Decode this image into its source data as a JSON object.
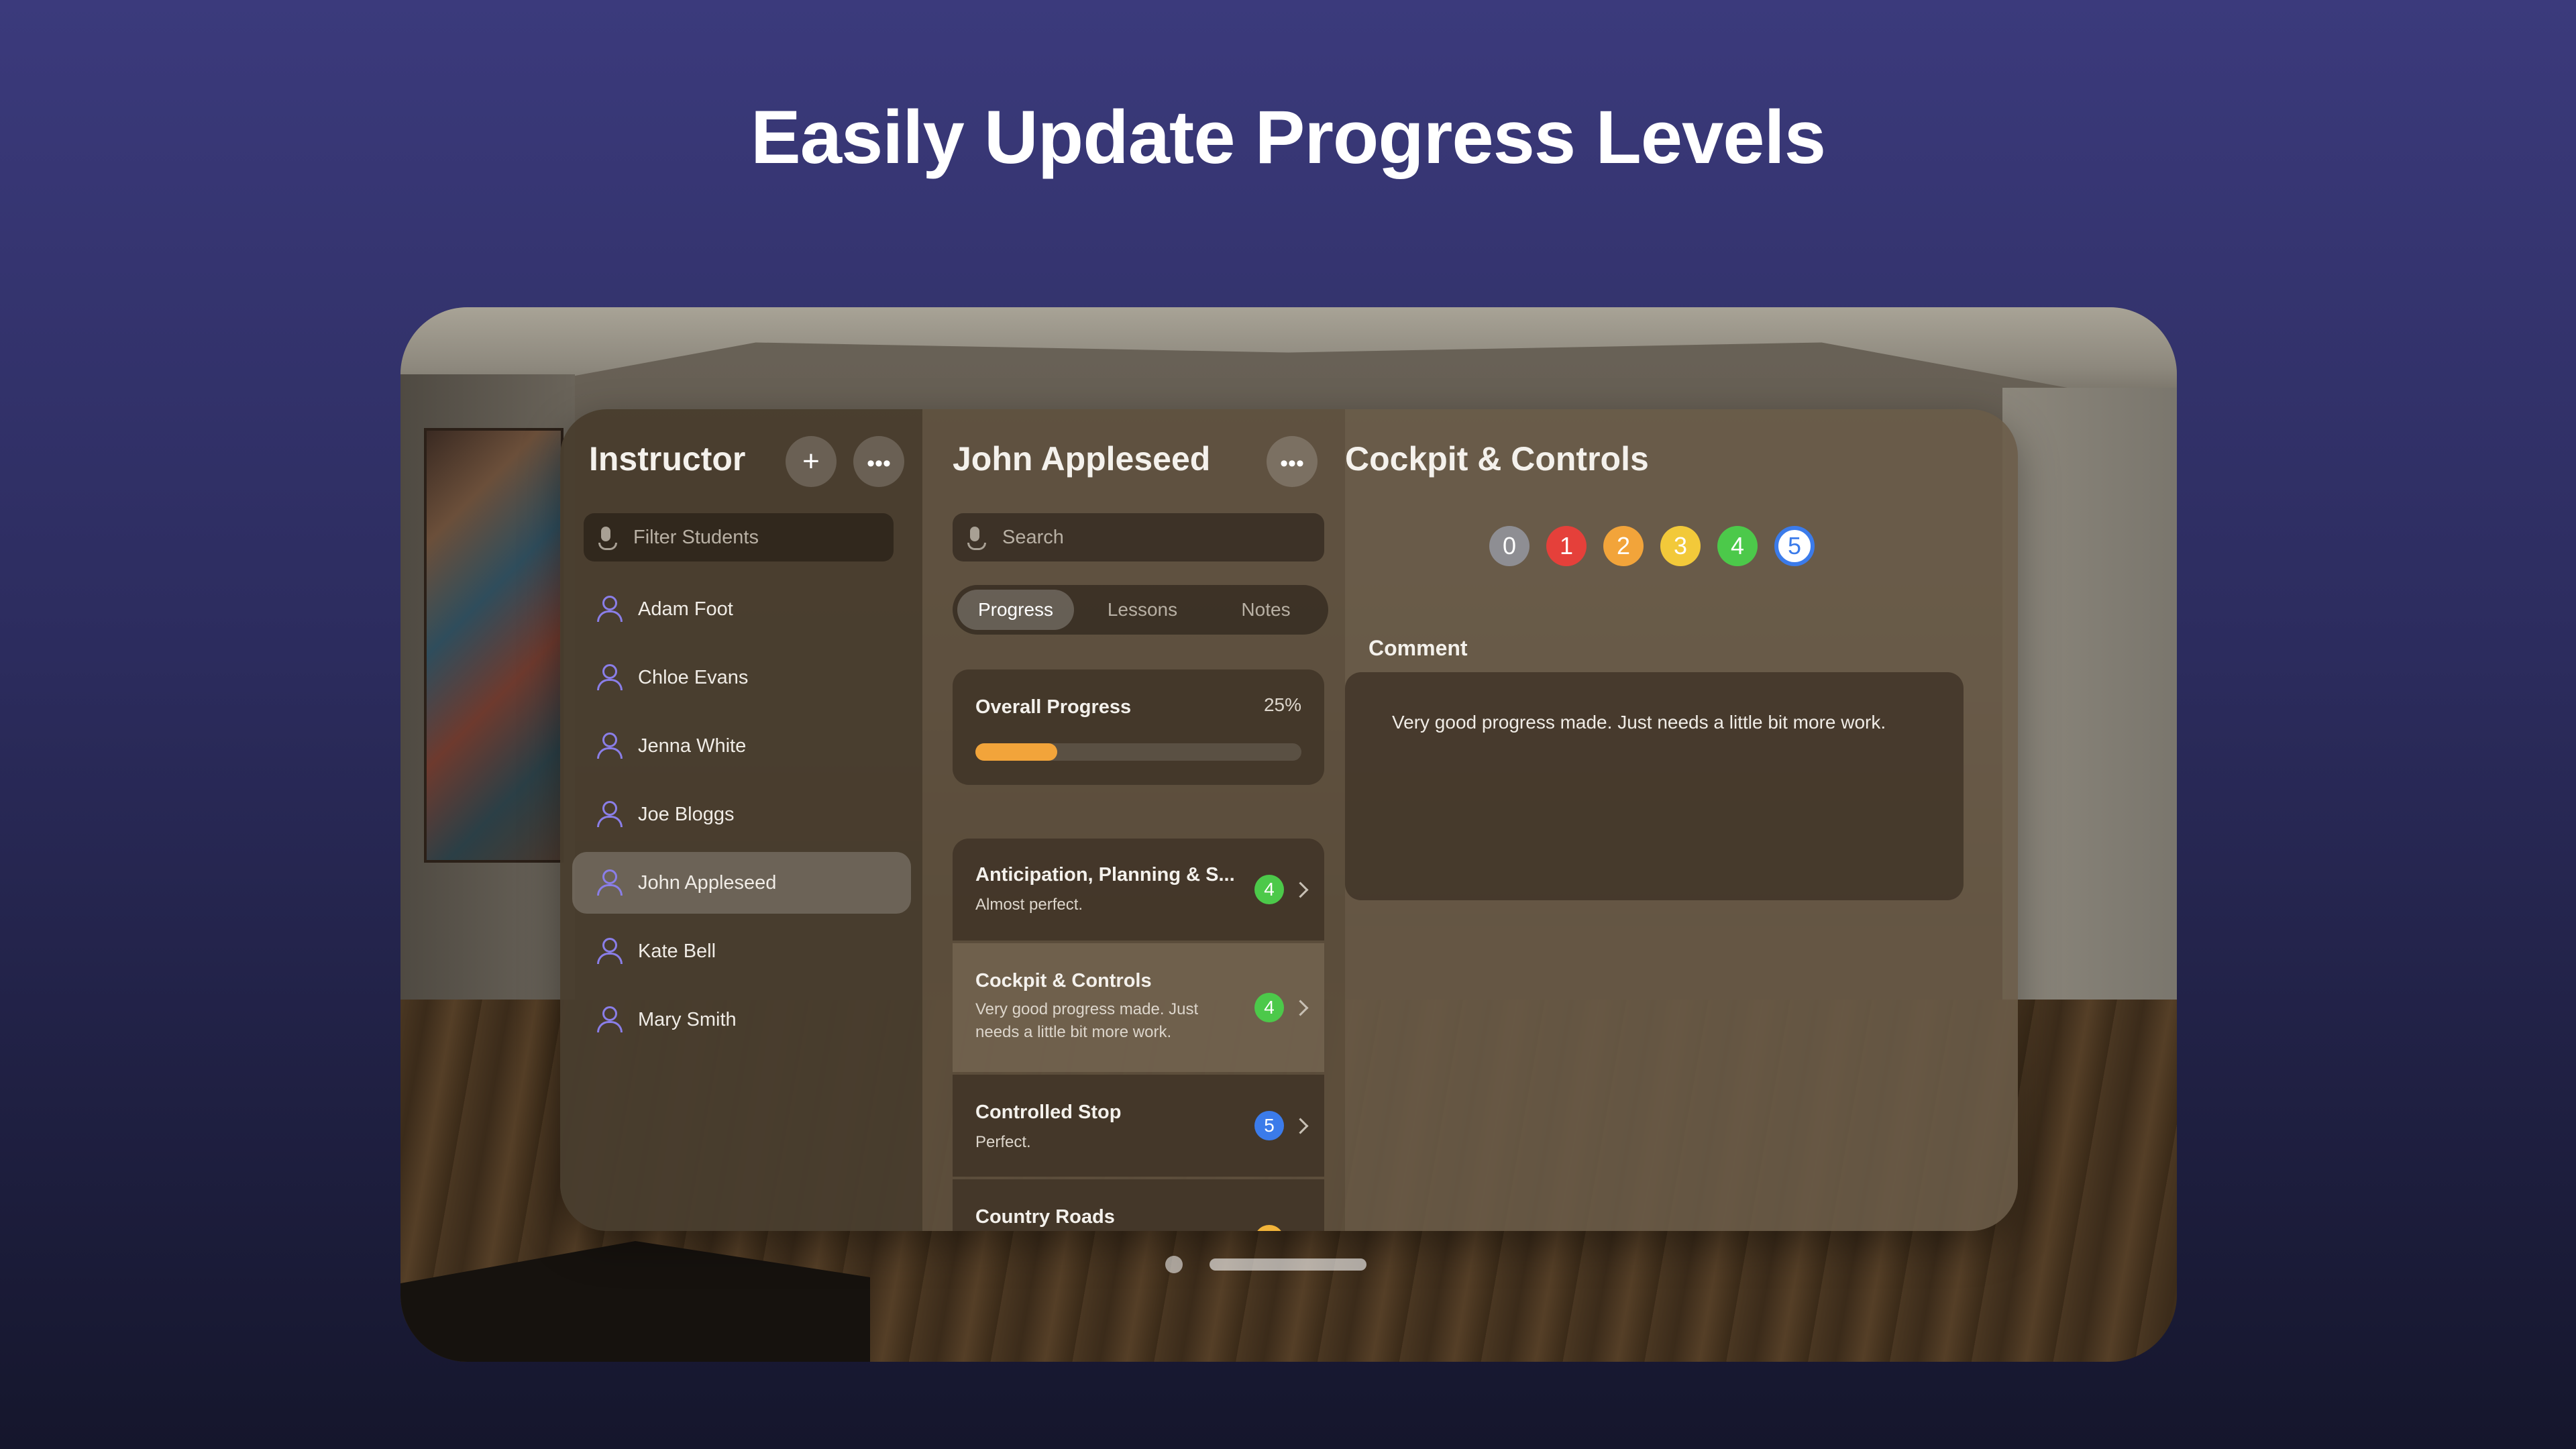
{
  "headline": "Easily Update Progress Levels",
  "sidebar": {
    "title": "Instructor",
    "add_icon": "plus-icon",
    "more_icon": "ellipsis-icon",
    "filter_placeholder": "Filter Students",
    "students": [
      {
        "name": "Adam Foot",
        "selected": false
      },
      {
        "name": "Chloe Evans",
        "selected": false
      },
      {
        "name": "Jenna White",
        "selected": false
      },
      {
        "name": "Joe Bloggs",
        "selected": false
      },
      {
        "name": "John Appleseed",
        "selected": true
      },
      {
        "name": "Kate Bell",
        "selected": false
      },
      {
        "name": "Mary Smith",
        "selected": false
      }
    ]
  },
  "student_pane": {
    "title": "John Appleseed",
    "search_placeholder": "Search",
    "tabs": [
      "Progress",
      "Lessons",
      "Notes"
    ],
    "active_tab": "Progress",
    "overall": {
      "label": "Overall Progress",
      "value_text": "25%",
      "fraction": 0.25
    },
    "lessons": [
      {
        "title": "Anticipation, Planning & S...",
        "note": "Almost perfect.",
        "level": "4",
        "level_color": "#4cc94a"
      },
      {
        "title": "Cockpit & Controls",
        "note": "Very good progress made. Just needs a little bit more work.",
        "note_lines": [
          "Very good progress made. Just",
          "needs a little bit more work."
        ],
        "level": "4",
        "level_color": "#4cc94a"
      },
      {
        "title": "Controlled Stop",
        "note": "Perfect.",
        "level": "5",
        "level_color": "#3b7bea"
      },
      {
        "title": "Country Roads",
        "note": "",
        "level": "",
        "level_color": "#f2b43a"
      }
    ]
  },
  "detail": {
    "title": "Cockpit & Controls",
    "levels": [
      {
        "label": "0",
        "color": "#8e8e93"
      },
      {
        "label": "1",
        "color": "#e5403a"
      },
      {
        "label": "2",
        "color": "#f2a43a"
      },
      {
        "label": "3",
        "color": "#f2c93a"
      },
      {
        "label": "4",
        "color": "#4cc94a"
      },
      {
        "label": "5",
        "color": "#3b7bea",
        "selected": true
      }
    ],
    "comment_label": "Comment",
    "comment": "Very good progress made. Just needs a little bit more work."
  }
}
